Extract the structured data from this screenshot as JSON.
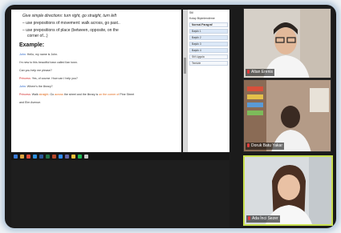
{
  "document": {
    "direction_line": "Give simple directions: turn right, go straight, turn left",
    "bullets": [
      "use prepositions of movement: walk across, go past..",
      "use prepositions of place (between, opposite, on the",
      "corner of...)"
    ],
    "example_heading": "Example:",
    "dialogue": [
      {
        "speaker": "John:",
        "text": "Hello, my name is John."
      },
      {
        "speaker": "",
        "text": "I'm new to this beautiful town called Ilan town."
      },
      {
        "speaker": "",
        "text": "Can you help me please?"
      },
      {
        "speaker": "Princess:",
        "text": "Yes, of course. How can I help you?"
      },
      {
        "speaker": "John:",
        "text": "Where's the library?"
      },
      {
        "speaker": "Princess:",
        "text_parts": [
          "Walk ",
          "straight",
          ". Go ",
          "across",
          " the street and the library is ",
          "on the corner of",
          " Pine Street"
        ]
      },
      {
        "speaker": "",
        "text": "and Elm Avenue."
      }
    ]
  },
  "side_panel": {
    "title": "Stil",
    "sub_title": "Kolay Biçimlendirme",
    "items": [
      "Normal Paragraf",
      "Başlık 1",
      "Başlık 2",
      "Başlık 3",
      "Başlık 4",
      "Stil Uygula",
      "Temizle"
    ]
  },
  "participants": [
    {
      "name": "Altan Erenis"
    },
    {
      "name": "Doruk Batu Yakar"
    },
    {
      "name": "Ada İnci Sezer"
    }
  ],
  "colors": {
    "active_speaker_border": "#c9e050",
    "frame_glow": "#96b2cd"
  }
}
